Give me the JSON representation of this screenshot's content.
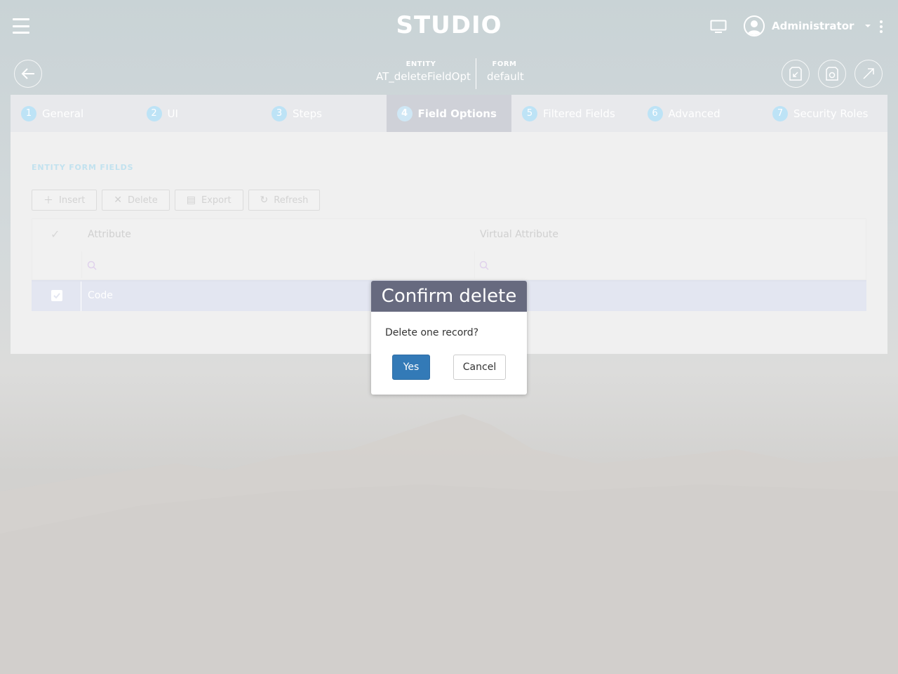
{
  "header": {
    "app_title": "STUDIO",
    "user_name": "Administrator"
  },
  "entity_info": {
    "entity_label": "ENTITY",
    "entity_value": "AT_deleteFieldOpt",
    "form_label": "FORM",
    "form_value": "default"
  },
  "tabs": [
    {
      "num": "1",
      "label": "General"
    },
    {
      "num": "2",
      "label": "UI"
    },
    {
      "num": "3",
      "label": "Steps"
    },
    {
      "num": "4",
      "label": "Field Options"
    },
    {
      "num": "5",
      "label": "Filtered Fields"
    },
    {
      "num": "6",
      "label": "Advanced"
    },
    {
      "num": "7",
      "label": "Security Roles"
    }
  ],
  "section": {
    "title": "ENTITY FORM FIELDS"
  },
  "toolbar": {
    "insert_label": "Insert",
    "delete_label": "Delete",
    "export_label": "Export",
    "refresh_label": "Refresh"
  },
  "grid": {
    "columns": [
      "Attribute",
      "Virtual Attribute"
    ],
    "rows": [
      {
        "attribute": "Code",
        "virtual_attribute": "",
        "selected": true
      }
    ]
  },
  "dialog": {
    "title": "Confirm delete",
    "message": "Delete one record?",
    "yes_label": "Yes",
    "cancel_label": "Cancel"
  },
  "colors": {
    "primary": "#337ab7",
    "dialog_header": "#676a7f",
    "selected_row": "#e3e6f1"
  }
}
